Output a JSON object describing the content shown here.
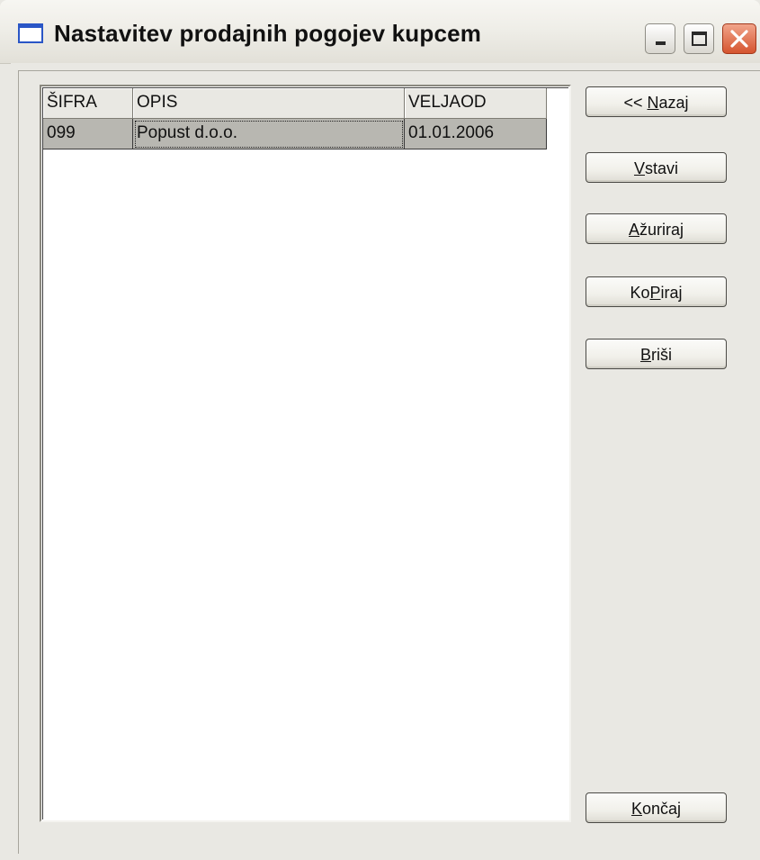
{
  "window": {
    "title": "Nastavitev prodajnih pogojev kupcem"
  },
  "table": {
    "columns": [
      "ŠIFRA",
      "OPIS",
      "VELJAOD"
    ],
    "rows": [
      [
        "099",
        "Popust d.o.o.",
        "01.01.2006"
      ]
    ]
  },
  "buttons": {
    "back": {
      "before": "<< ",
      "mnemonic": "N",
      "after": "azaj"
    },
    "insert": {
      "before": "",
      "mnemonic": "V",
      "after": "stavi"
    },
    "update": {
      "before": "",
      "mnemonic": "A",
      "after": "žuriraj"
    },
    "copy": {
      "before": "Ko",
      "mnemonic": "P",
      "after": "iraj"
    },
    "delete": {
      "before": "",
      "mnemonic": "B",
      "after": "riši"
    },
    "finish": {
      "before": "",
      "mnemonic": "K",
      "after": "Končaj"
    }
  },
  "colors": {
    "title_icon_accent": "#2a56c6",
    "close_button": "#d5542f",
    "selected_row": "#b8b7b1"
  },
  "icons": {
    "title": "window-icon",
    "minimize": "minimize-icon",
    "maximize": "maximize-icon",
    "close": "close-icon"
  }
}
